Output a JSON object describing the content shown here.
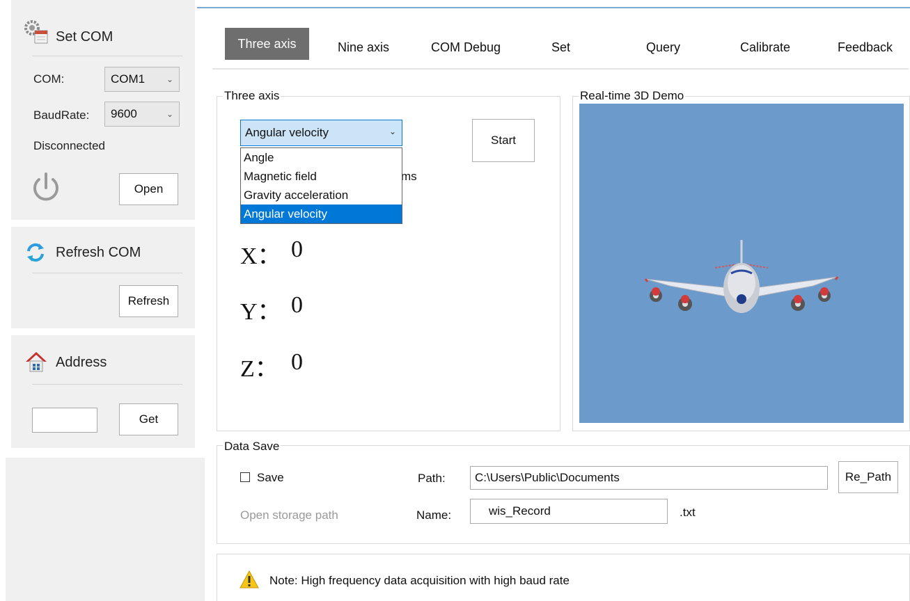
{
  "sidebar": {
    "set_com": {
      "title": "Set COM",
      "com_label": "COM:",
      "com_value": "COM1",
      "baud_label": "BaudRate:",
      "baud_value": "9600",
      "status": "Disconnected",
      "open_label": "Open"
    },
    "refresh": {
      "title": "Refresh COM",
      "button_label": "Refresh"
    },
    "address": {
      "title": "Address",
      "input_value": "",
      "button_label": "Get"
    }
  },
  "tabs": [
    {
      "label": "Three axis",
      "active": true
    },
    {
      "label": "Nine axis"
    },
    {
      "label": "COM Debug"
    },
    {
      "label": "Set"
    },
    {
      "label": "Query"
    },
    {
      "label": "Calibrate"
    },
    {
      "label": "Feedback"
    }
  ],
  "three_axis": {
    "group_title": "Three axis",
    "selected": "Angular velocity",
    "options": [
      "Angle",
      "Magnetic field",
      "Gravity acceleration",
      "Angular velocity"
    ],
    "hidden_text_fragment": "ms",
    "start_label": "Start",
    "x_label": "X：",
    "x_value": "0",
    "y_label": "Y：",
    "y_value": "0",
    "z_label": "Z：",
    "z_value": "0"
  },
  "demo": {
    "group_title": "Real-time 3D Demo",
    "background": "#6b9acb"
  },
  "data_save": {
    "group_title": "Data Save",
    "save_label": "Save",
    "save_checked": false,
    "path_label": "Path:",
    "path_value": "C:\\Users\\Public\\Documents",
    "repath_label": "Re_Path",
    "open_storage_label": "Open storage path",
    "name_label": "Name:",
    "name_value": "wis_Record",
    "ext": ".txt"
  },
  "note": {
    "text": "Note: High frequency data acquisition with high baud rate"
  },
  "colors": {
    "accent": "#0078d7",
    "active_tab": "#6e6e6e",
    "sidebar_bg": "#f0f0f0"
  }
}
